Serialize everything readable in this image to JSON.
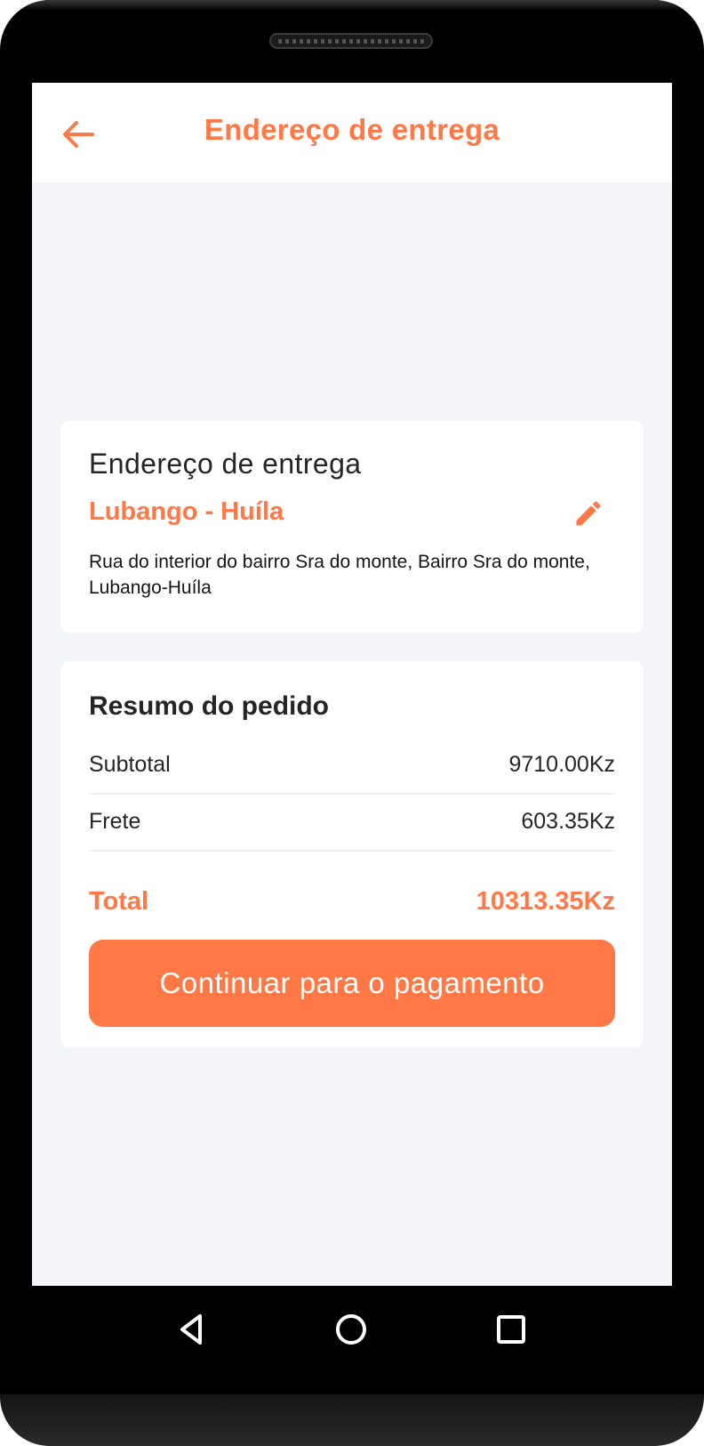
{
  "app_bar": {
    "title": "Endereço de entrega",
    "back_icon": "arrow-left-icon",
    "accent_color": "#ff7846"
  },
  "address": {
    "heading": "Endereço de entrega",
    "city": "Lubango - Huíla",
    "address_line": "Rua do interior do bairro Sra do monte, Bairro Sra do monte, Lubango-Huíla",
    "edit_icon": "pencil-icon"
  },
  "summary": {
    "heading": "Resumo do pedido",
    "rows": [
      {
        "label": "Subtotal",
        "value": "9710.00Kz"
      },
      {
        "label": "Frete",
        "value": "603.35Kz"
      }
    ],
    "total_label": "Total",
    "total_value": "10313.35Kz",
    "button_label": "Continuar para o pagamento"
  },
  "system_nav": {
    "icons": [
      "triangle-back-icon",
      "circle-home-icon",
      "square-recents-icon"
    ]
  }
}
